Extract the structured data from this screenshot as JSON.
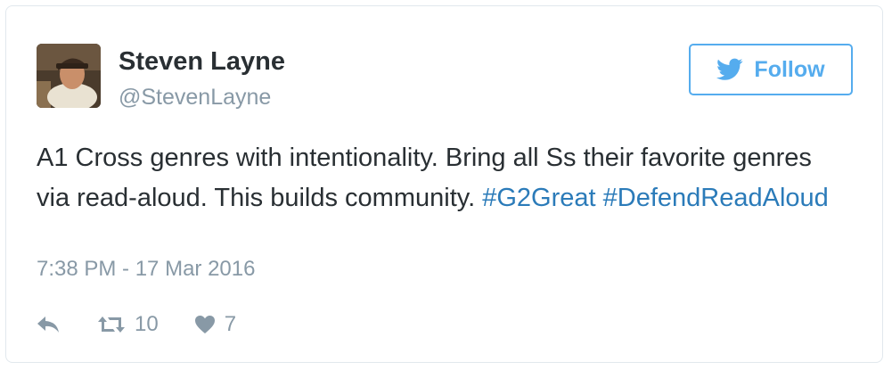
{
  "author": {
    "name": "Steven Layne",
    "handle": "@StevenLayne"
  },
  "follow_button": {
    "label": "Follow",
    "icon": "twitter-bird-icon",
    "color": "#55acee"
  },
  "tweet": {
    "text_plain": "A1 Cross genres with intentionality. Bring all Ss their favorite genres via read-aloud. This builds community.",
    "hashtag_1": "#G2Great",
    "hashtag_2": "#DefendReadAloud",
    "timestamp": "7:38 PM - 17 Mar 2016"
  },
  "actions": {
    "reply_icon": "reply-icon",
    "retweet_icon": "retweet-icon",
    "retweet_count": "10",
    "like_icon": "heart-icon",
    "like_count": "7"
  },
  "colors": {
    "text": "#292f33",
    "muted": "#8899a6",
    "link": "#2b7bb9",
    "border": "#e1e8ed"
  }
}
